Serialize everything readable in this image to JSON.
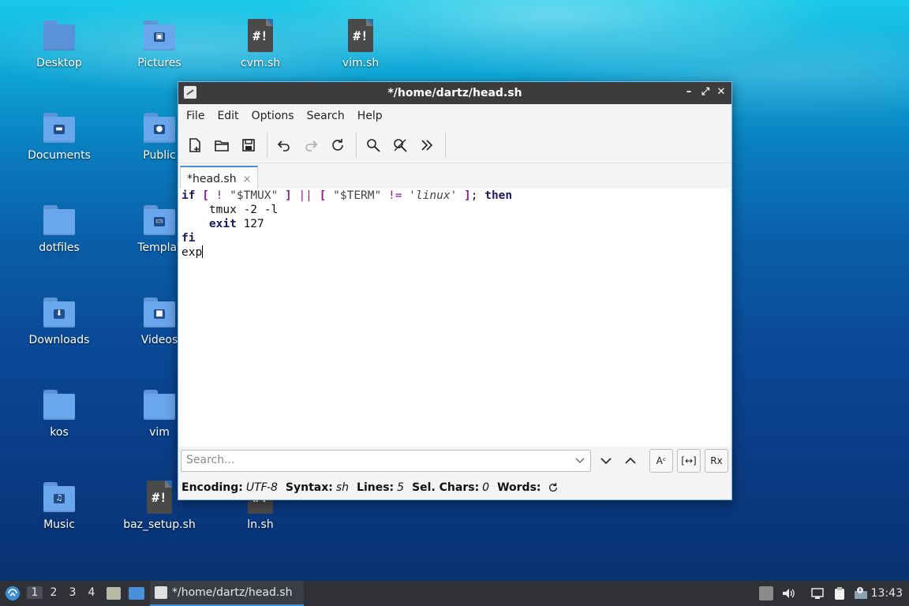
{
  "desktop": {
    "icons": [
      {
        "label": "Desktop",
        "kind": "folder",
        "badge": ""
      },
      {
        "label": "Pictures",
        "kind": "folder",
        "badge": "▣"
      },
      {
        "label": "cvm.sh",
        "kind": "script",
        "mark": "#!"
      },
      {
        "label": "vim.sh",
        "kind": "script",
        "mark": "#!"
      },
      {
        "label": "Documents",
        "kind": "folder",
        "badge": "▬"
      },
      {
        "label": "Public",
        "kind": "folder",
        "badge": "●"
      },
      {
        "label": "dotfiles",
        "kind": "folder",
        "badge": ""
      },
      {
        "label": "Templat",
        "kind": "folder",
        "badge": "▭"
      },
      {
        "label": "Downloads",
        "kind": "folder",
        "badge": "⬇"
      },
      {
        "label": "Videos",
        "kind": "folder",
        "badge": "■"
      },
      {
        "label": "kos",
        "kind": "folder",
        "badge": ""
      },
      {
        "label": "vim",
        "kind": "folder",
        "badge": ""
      },
      {
        "label": "Music",
        "kind": "folder",
        "badge": "♫"
      },
      {
        "label": "baz_setup.sh",
        "kind": "script",
        "mark": "#!"
      },
      {
        "label": "ln.sh",
        "kind": "script",
        "mark": "#!"
      }
    ]
  },
  "window": {
    "title": "*/home/dartz/head.sh",
    "controls": {
      "minimize": "–",
      "maximize": "⤢",
      "close": "✕"
    },
    "menu": [
      "File",
      "Edit",
      "Options",
      "Search",
      "Help"
    ],
    "toolbar": [
      "new-file-icon",
      "open-file-icon",
      "save-icon",
      "undo-icon",
      "redo-icon",
      "reload-icon",
      "find-icon",
      "find-replace-icon",
      "more-icon"
    ],
    "tab": {
      "label": "*head.sh",
      "close": "×"
    },
    "code": {
      "l1": {
        "if": "if",
        "b1": "[",
        "bang": "!",
        "tmux": "\"$TMUX\"",
        "b2": "]",
        "or": "||",
        "b3": "[",
        "term": "\"$TERM\"",
        "neq": "!=",
        "linux": "'linux'",
        "b4": "]",
        "semi": ";",
        "then": "then"
      },
      "l2": {
        "text": "tmux -2 -l"
      },
      "l3": {
        "exit": "exit",
        "code": "127"
      },
      "l4": {
        "fi": "fi"
      },
      "l5": {
        "text": "exp"
      }
    },
    "search": {
      "placeholder": "Search...",
      "opt_case": "Aᶜ",
      "opt_word": "[↔]",
      "opt_regex": "Rx"
    },
    "status": {
      "encoding_label": "Encoding:",
      "encoding": "UTF-8",
      "syntax_label": "Syntax:",
      "syntax": "sh",
      "lines_label": "Lines:",
      "lines": "5",
      "sel_label": "Sel. Chars:",
      "sel": "0",
      "words_label": "Words:"
    }
  },
  "taskbar": {
    "workspaces": [
      "1",
      "2",
      "3",
      "4"
    ],
    "active_workspace": "1",
    "task_title": "*/home/dartz/head.sh",
    "clock": "13:43"
  },
  "colors": {
    "accent": "#3b8fd6",
    "titlebar": "#3c3c3c",
    "folder": "#6aa6ec"
  }
}
